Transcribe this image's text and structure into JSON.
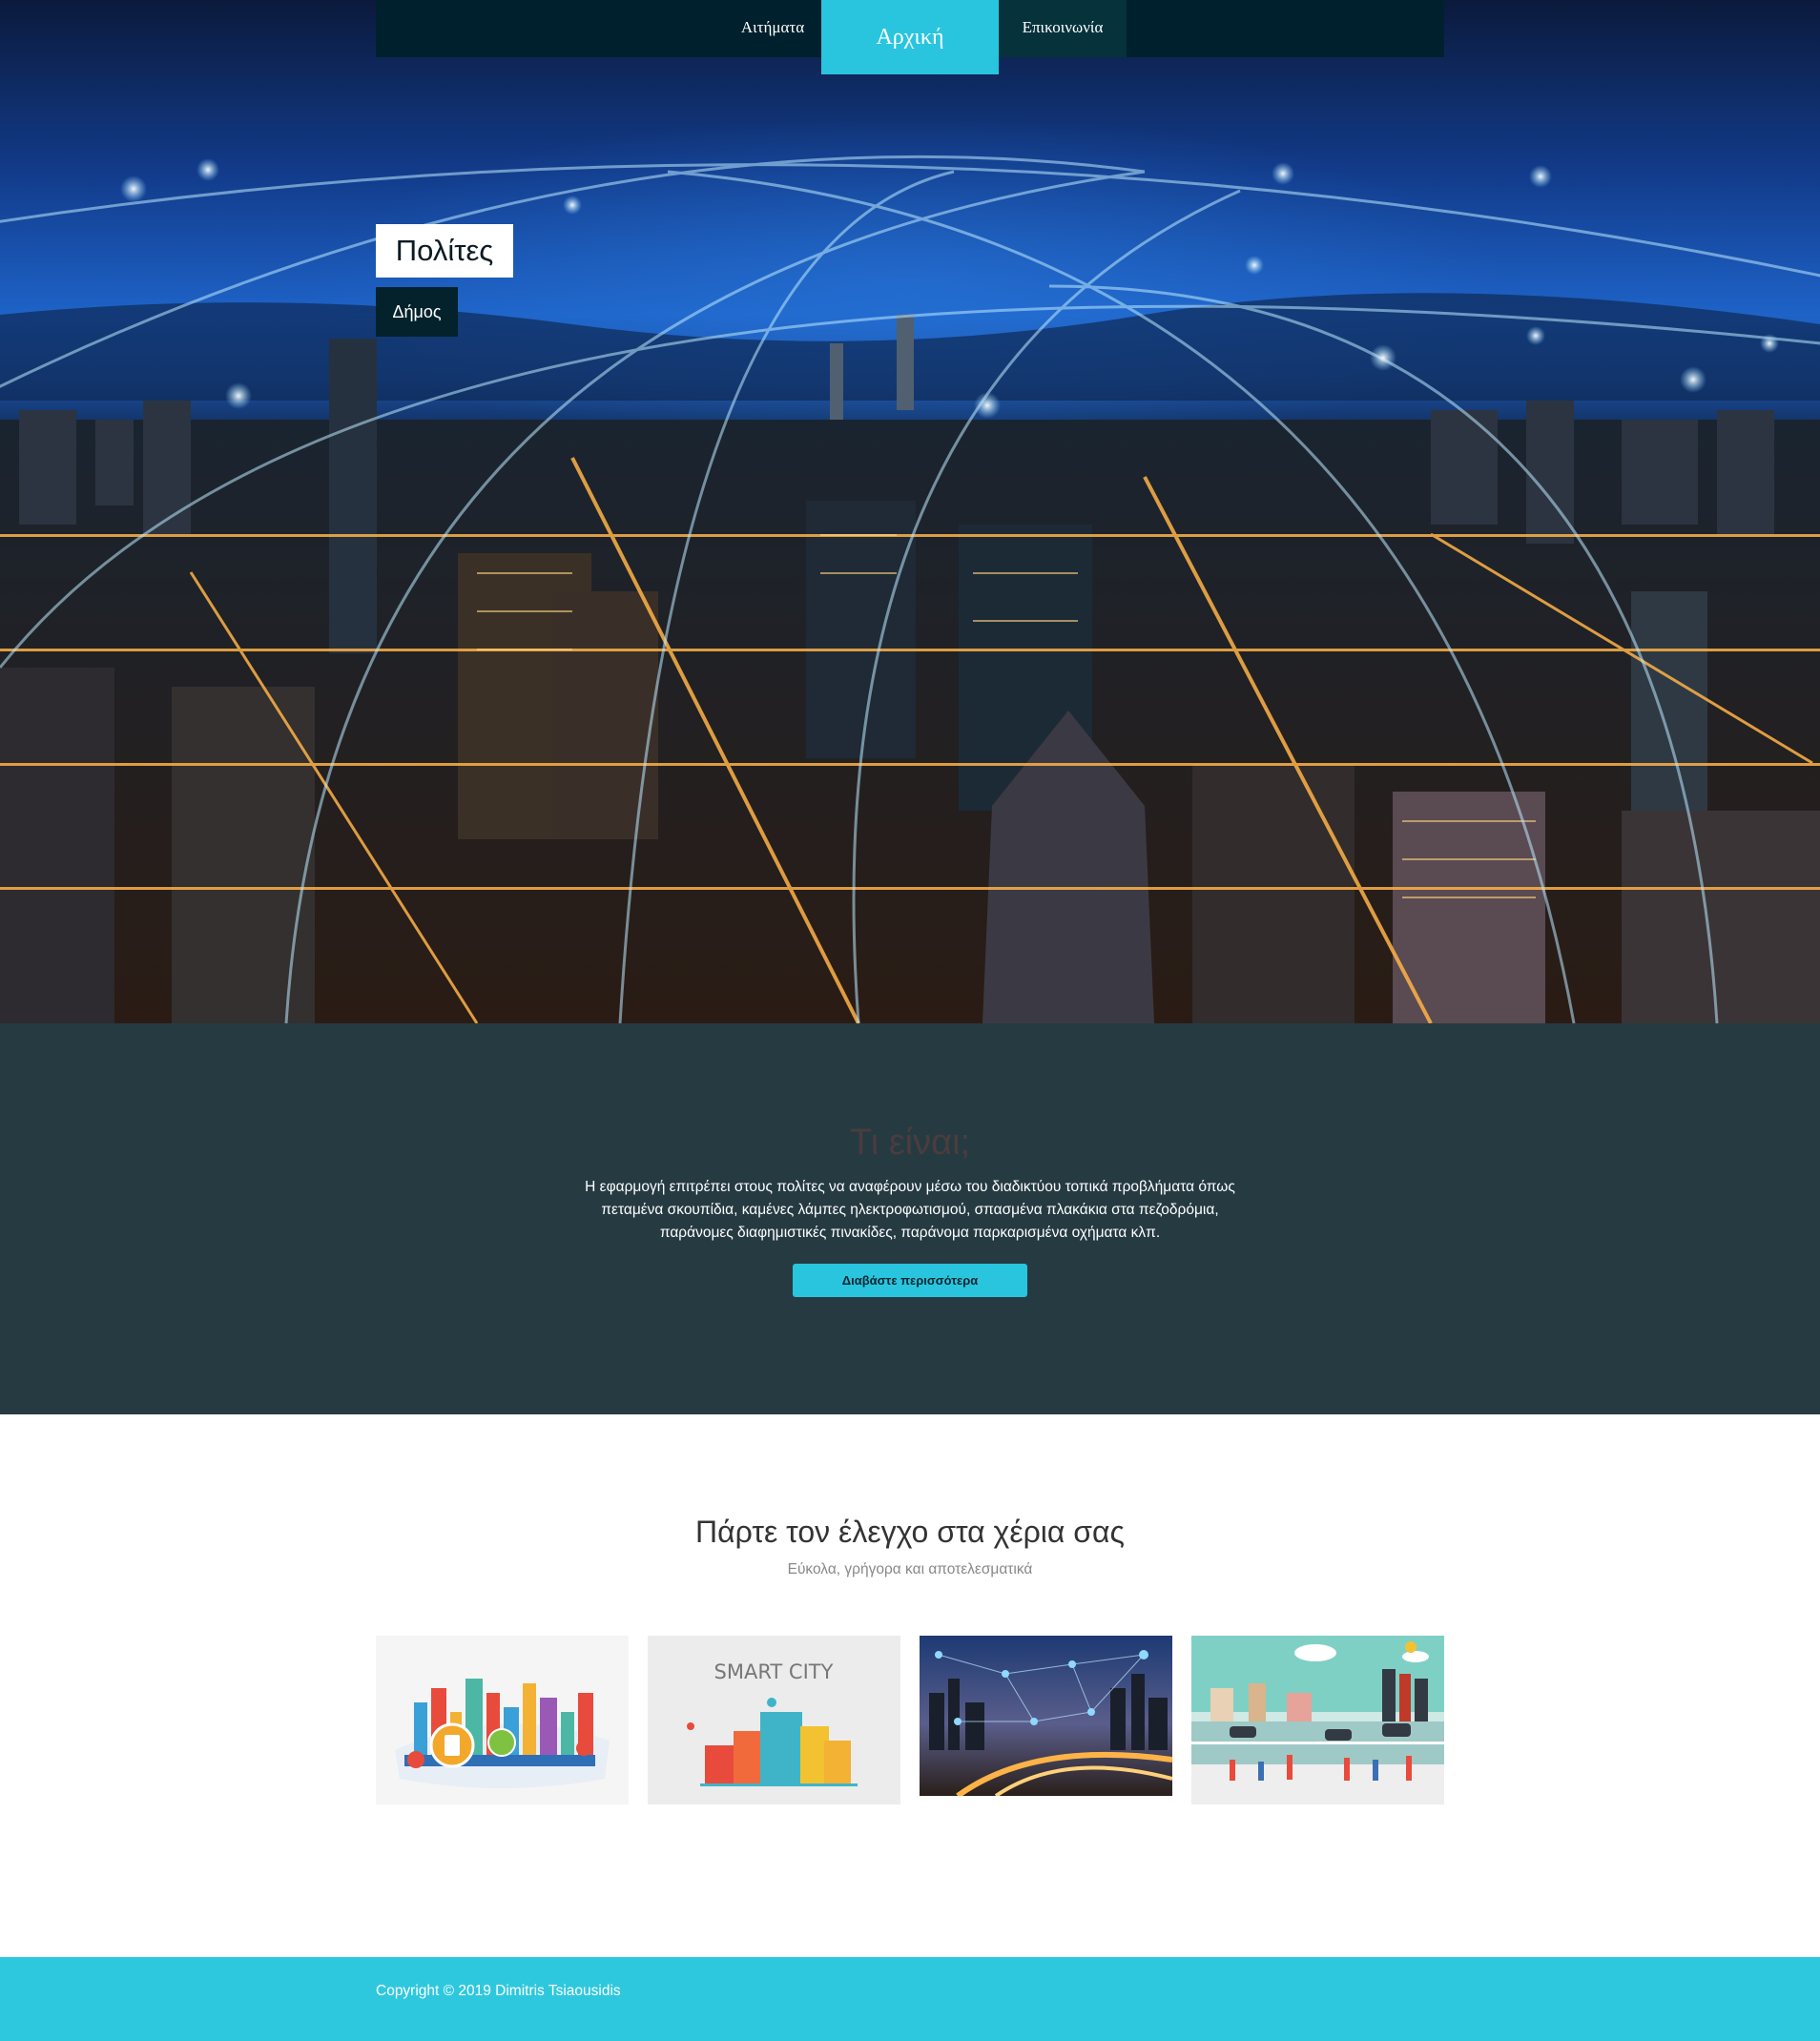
{
  "nav": {
    "items": [
      {
        "label": "Αιτήματα"
      },
      {
        "label": "Αρχική"
      },
      {
        "label": "Επικοινωνία"
      }
    ]
  },
  "hero": {
    "title": "Πολίτες",
    "subtitle": "Δήμος"
  },
  "about": {
    "title": "Τι είναι;",
    "text": "Η εφαρμογή επιτρέπει στους πολίτες να αναφέρουν μέσω του διαδικτύου τοπικά προβλήματα όπως πεταμένα σκουπίδια, καμένες λάμπες ηλεκτροφωτισμού, σπασμένα πλακάκια στα πεζοδρόμια, παράνομες διαφημιστικές πινακίδες, παράνομα παρκαρισμένα οχήματα κλπ.",
    "button_label": "Διαβάστε περισσότερα"
  },
  "features": {
    "title": "Πάρτε τον έλεγχο στα χέρια σας",
    "subtitle": "Εύκολα, γρήγορα και αποτελεσματικά",
    "images": [
      {
        "icon": "smart-city-illustration-image"
      },
      {
        "icon": "smart-city-buildings-image",
        "caption": "SMART CITY"
      },
      {
        "icon": "connected-city-night-image"
      },
      {
        "icon": "city-street-people-image"
      }
    ]
  },
  "footer": {
    "copyright": "Copyright © 2019 Dimitris Tsiaousidis"
  },
  "colors": {
    "accent": "#29c5de",
    "nav_bg": "#00202d",
    "about_bg": "#263a42",
    "footer_bg": "#2ec8de"
  }
}
